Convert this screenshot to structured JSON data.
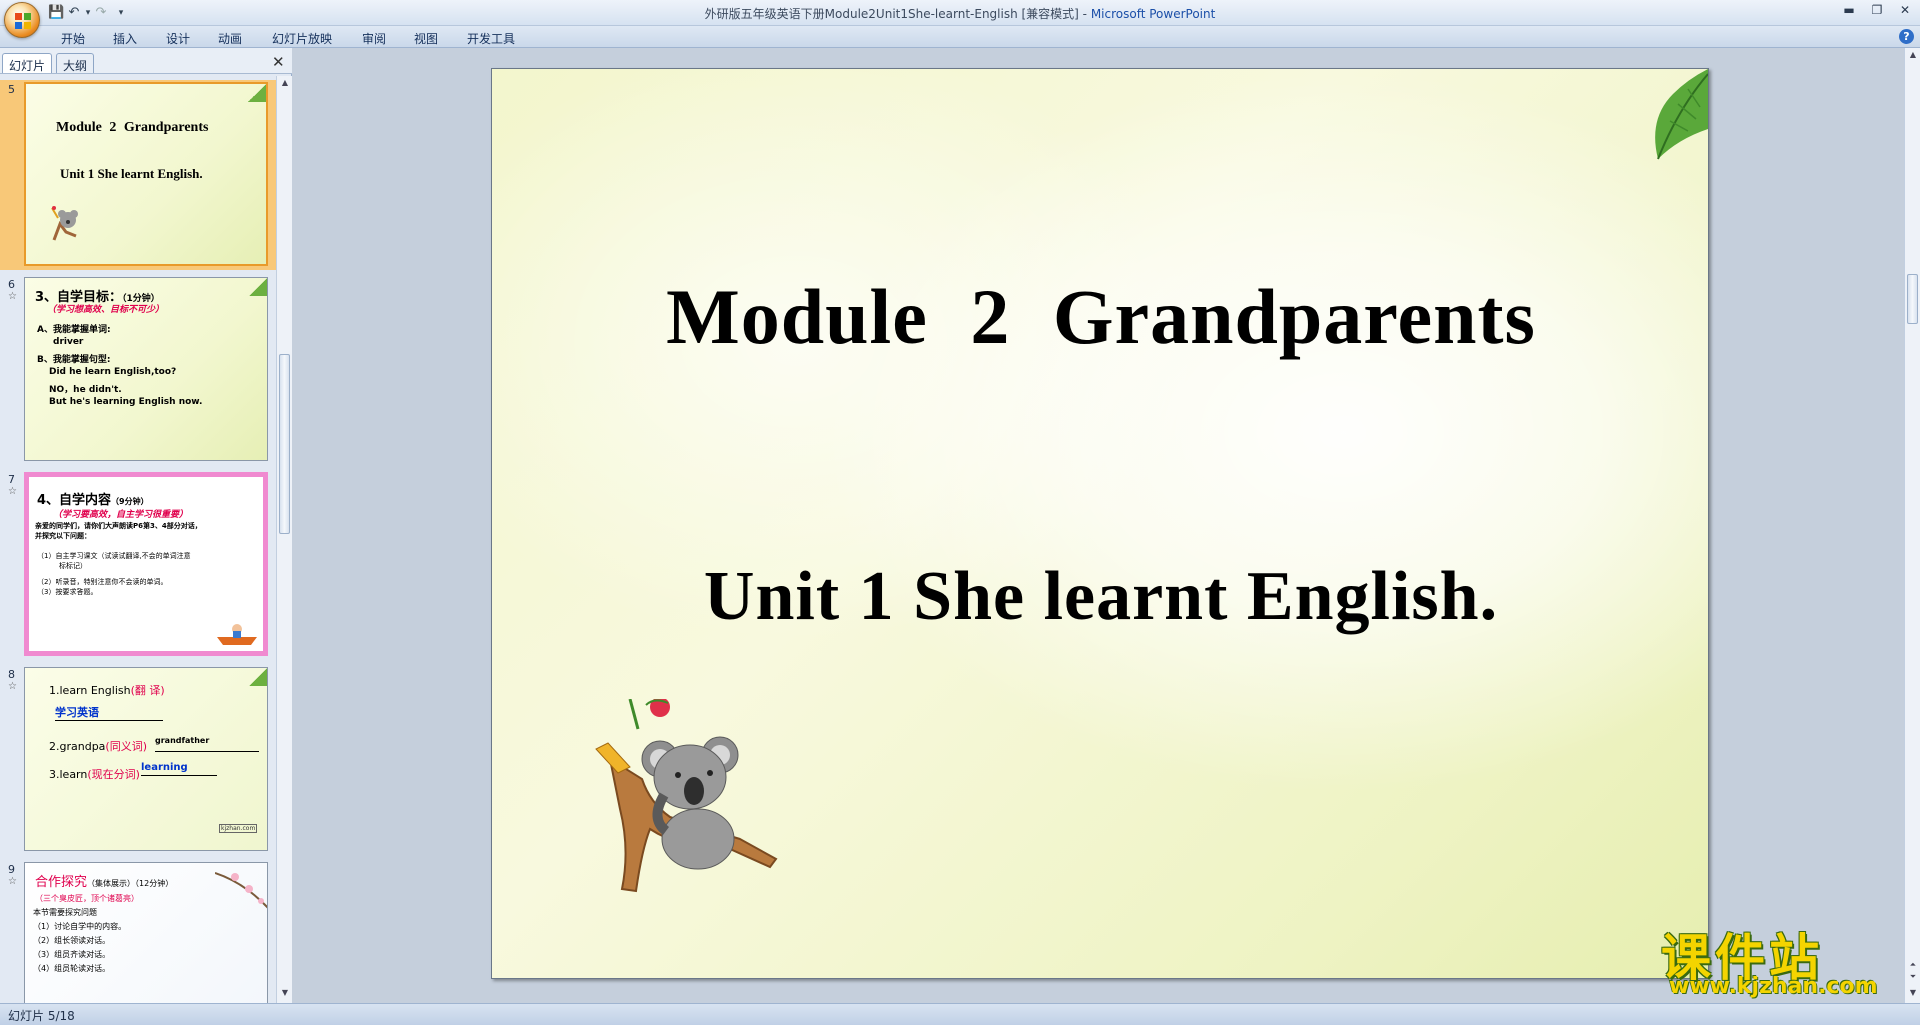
{
  "window": {
    "title": "外研版五年级英语下册Module2Unit1She-learnt-English [兼容模式] - ",
    "app": "Microsoft PowerPoint"
  },
  "ribbon": {
    "tabs": [
      "开始",
      "插入",
      "设计",
      "动画",
      "幻灯片放映",
      "审阅",
      "视图",
      "开发工具"
    ]
  },
  "panel": {
    "tabs": [
      "幻灯片",
      "大纲"
    ],
    "close": "✕"
  },
  "thumbnails": [
    {
      "number": "5",
      "title": "Module 2   Grandparents",
      "subtitle": "Unit 1 She learnt English."
    },
    {
      "number": "6",
      "heading": "3、自学目标：",
      "heading_note": "（1分钟）",
      "red_note": "（学习想高效、目标不可少）",
      "lines": [
        "A、我能掌握单词:",
        "driver",
        "B、我能掌握句型:",
        "Did  he learn English,too?",
        "NO，he didn't.",
        "But he's learning English now."
      ]
    },
    {
      "number": "7",
      "heading": "4、自学内容",
      "heading_note": "（9分钟）",
      "red_note": "（学习要高效，自主学习很重要）",
      "lines": [
        "亲爱的同学们，请你们大声朗读P6第3、4部分对话，",
        "并探究以下问题：",
        "（1）自主学习课文（试读试翻译,不会的单词注意",
        "标标记）",
        "（2）听录音，特别注意你不会读的单词。",
        "（3）按要求答题。"
      ]
    },
    {
      "number": "8",
      "items": [
        {
          "text": "1.learn English",
          "hint": "(翻  译)",
          "answer": "学习英语"
        },
        {
          "text": "2.grandpa",
          "hint": "(同义词)",
          "answer": "grandfather"
        },
        {
          "text": "3.learn",
          "hint": "(现在分词)",
          "answer": "learning"
        }
      ],
      "tag": "kjzhan.com"
    },
    {
      "number": "9",
      "heading": "合作探究",
      "heading_note": "（集体展示）（12分钟）",
      "red_note": "（三个臭皮匠，顶个诸葛亮）",
      "lines": [
        "本节需要探究问题",
        "（1）讨论自学中的内容。",
        "（2）组长领读对话。",
        "（3）组员齐读对话。",
        "（4）组员轮读对话。"
      ]
    }
  ],
  "slide": {
    "title": "Module 2   Grandparents",
    "subtitle": "Unit 1 She learnt English."
  },
  "watermark": {
    "big": "课件站",
    "url": "www.kjzhan.com"
  },
  "status": {
    "text": "幻灯片 5/18"
  },
  "colors": {
    "accent": "#1b4fa8",
    "selection": "#f8c878",
    "red_note": "#e0004d",
    "blue_answer": "#0033cc"
  }
}
